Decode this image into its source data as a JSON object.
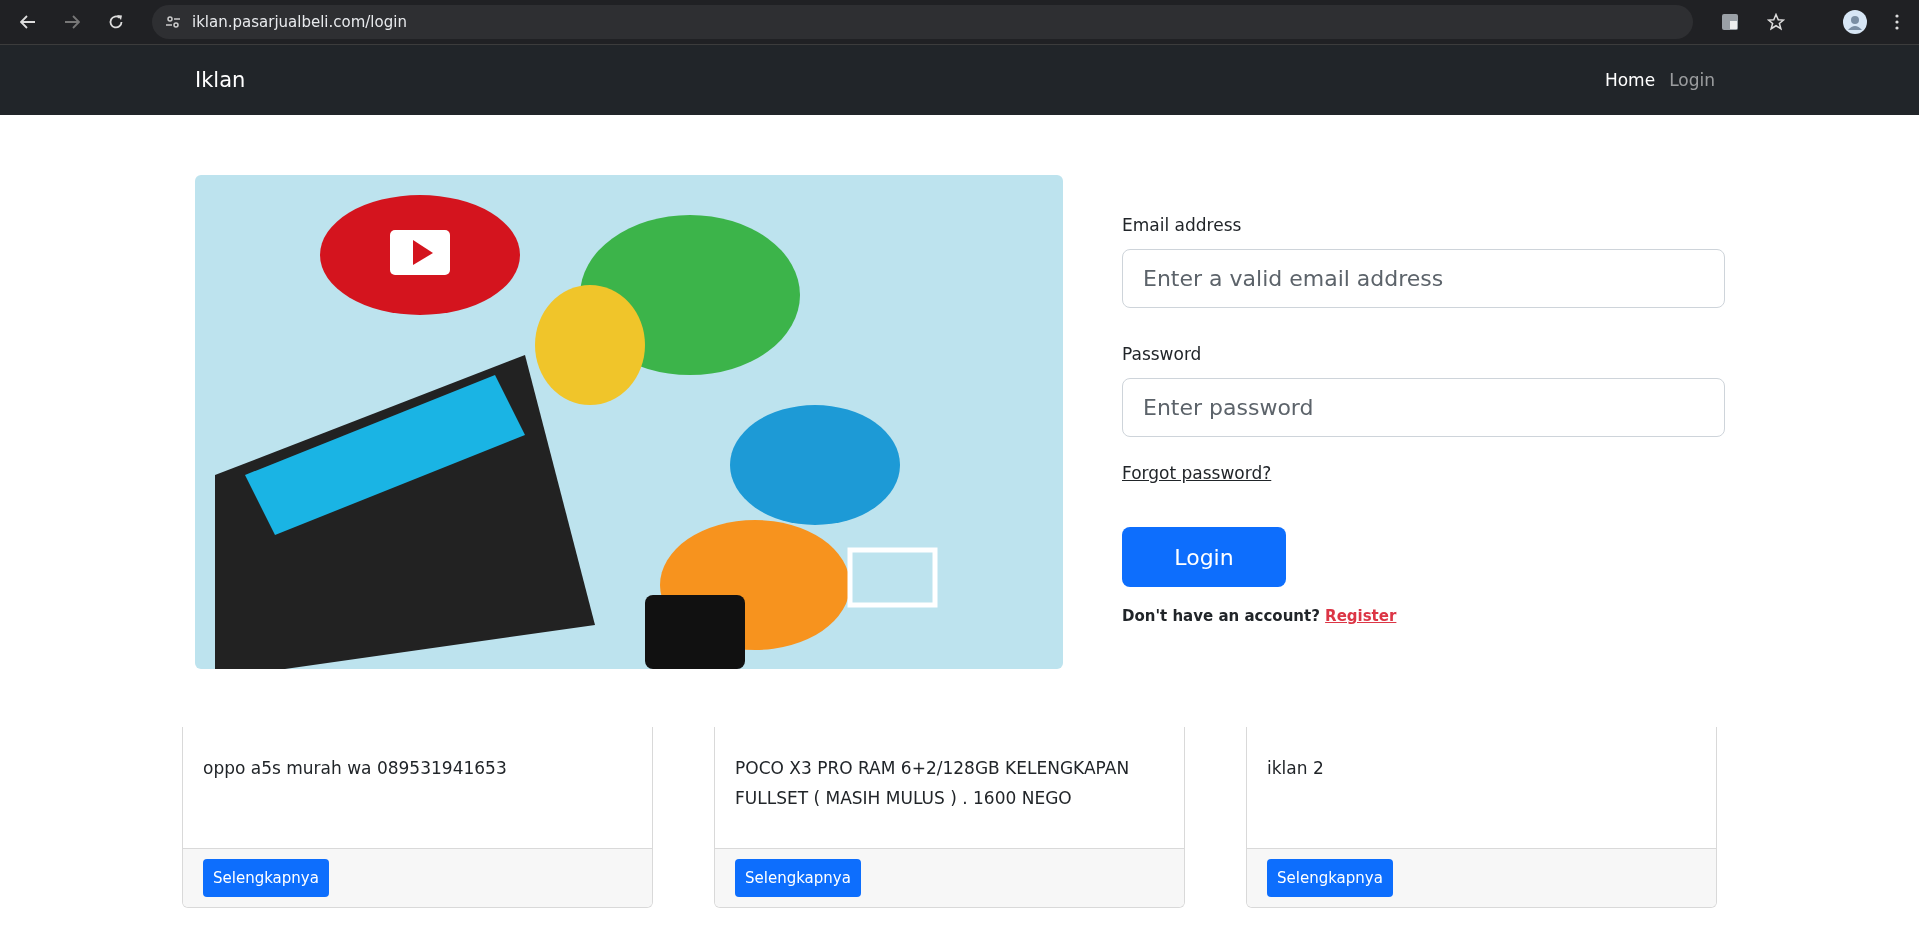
{
  "browser": {
    "url": "iklan.pasarjualbeli.com/login"
  },
  "navbar": {
    "brand": "Iklan",
    "links": [
      {
        "label": "Home",
        "selected": true
      },
      {
        "label": "Login",
        "selected": false
      }
    ]
  },
  "form": {
    "email_label": "Email address",
    "email_placeholder": "Enter a valid email address",
    "password_label": "Password",
    "password_placeholder": "Enter password",
    "forgot": "Forgot password?",
    "submit": "Login",
    "register_prompt": "Don't have an account?",
    "register_link": "Register"
  },
  "cards": [
    {
      "text": "oppo a5s murah wa 089531941653",
      "button": "Selengkapnya"
    },
    {
      "text": "POCO X3 PRO RAM 6+2/128GB KELENGKAPAN FULLSET ( MASIH MULUS ) . 1600 NEGO",
      "button": "Selengkapnya"
    },
    {
      "text": "iklan 2",
      "button": "Selengkapnya"
    }
  ]
}
